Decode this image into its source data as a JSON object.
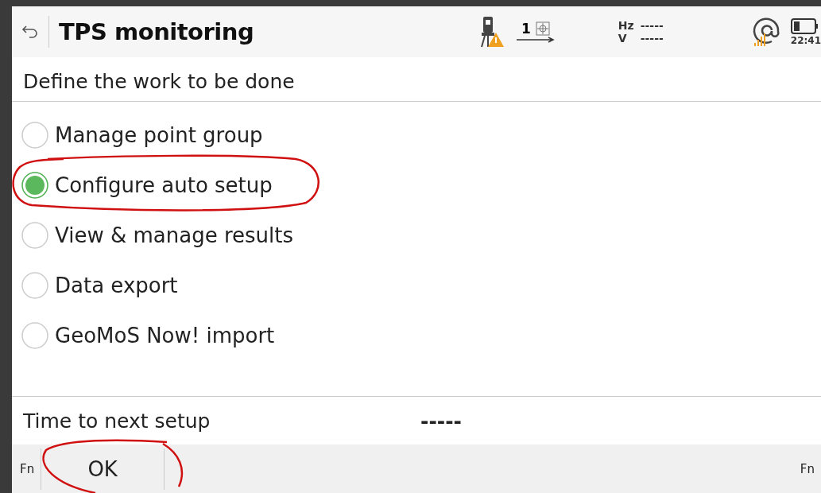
{
  "header": {
    "title": "TPS monitoring",
    "face_count": "1",
    "hz_label": "Hz",
    "hz_value": "-----",
    "v_label": "V",
    "v_value": "-----",
    "time": "22:41"
  },
  "prompt": "Define the work to be done",
  "options": [
    {
      "label": "Manage point group",
      "selected": false
    },
    {
      "label": "Configure auto setup",
      "selected": true
    },
    {
      "label": "View & manage results",
      "selected": false
    },
    {
      "label": "Data export",
      "selected": false
    },
    {
      "label": "GeoMoS Now! import",
      "selected": false
    }
  ],
  "next_setup": {
    "label": "Time to next setup",
    "value": "-----"
  },
  "softkeys": {
    "fn_left": "Fn",
    "ok": "OK",
    "fn_right": "Fn"
  }
}
